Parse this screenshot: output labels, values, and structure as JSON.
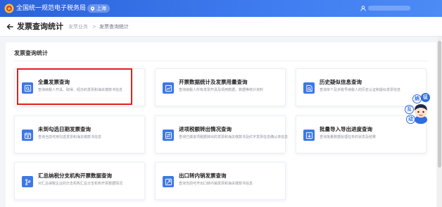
{
  "header": {
    "site_name": "全国统一规范电子税务局",
    "region": "上海"
  },
  "subheader": {
    "page_title": "发票查询统计",
    "breadcrumb": [
      "发票业务",
      ">",
      "发票查询统计"
    ]
  },
  "panel": {
    "title": "发票查询统计"
  },
  "cards": [
    {
      "title": "全量发票查询",
      "desc": "查询纳税人开具、取得、经办的发票和海关缴款书信息",
      "icon": "search-doc-icon"
    },
    {
      "title": "开票数据统计及发票用量查询",
      "desc": "查询纳税人所有发票开具及领用数据，数据等统计资料",
      "icon": "chart-icon"
    },
    {
      "title": "历史疑似信息查询",
      "desc": "查询单个及多税号纳税人的历史认证和疑似发票信息",
      "icon": "magnifier-doc-icon"
    },
    {
      "title": "未到勾选日期发票查询",
      "desc": "查询当前可用勾选发票和海关缴款书信息",
      "icon": "calendar-icon"
    },
    {
      "title": "进项税额转出情况查询",
      "desc": "查询已做进项税额转出的发票和海关缴款书及红字发票信息确认单信息",
      "icon": "transfer-doc-icon"
    },
    {
      "title": "批量导入导出进度查询",
      "desc": "查询批量数据处理任务的状态及结果",
      "icon": "progress-icon"
    },
    {
      "title": "汇总纳税分支机构开票数据查询",
      "desc": "对汇总纳税企业的分支机构汇总分支机构开票数据情况",
      "icon": "branch-icon"
    },
    {
      "title": "出口转内销发票查询",
      "desc": "查询当前可开出口转内销发票和海关缴款书信息",
      "icon": "export-doc-icon"
    }
  ],
  "assistant": {
    "chars": [
      "征",
      "纳",
      "互",
      "动"
    ]
  },
  "colors": {
    "header_blue": "#3470e4",
    "icon_blue": "#3d78e6",
    "highlight_red": "#e02020"
  }
}
